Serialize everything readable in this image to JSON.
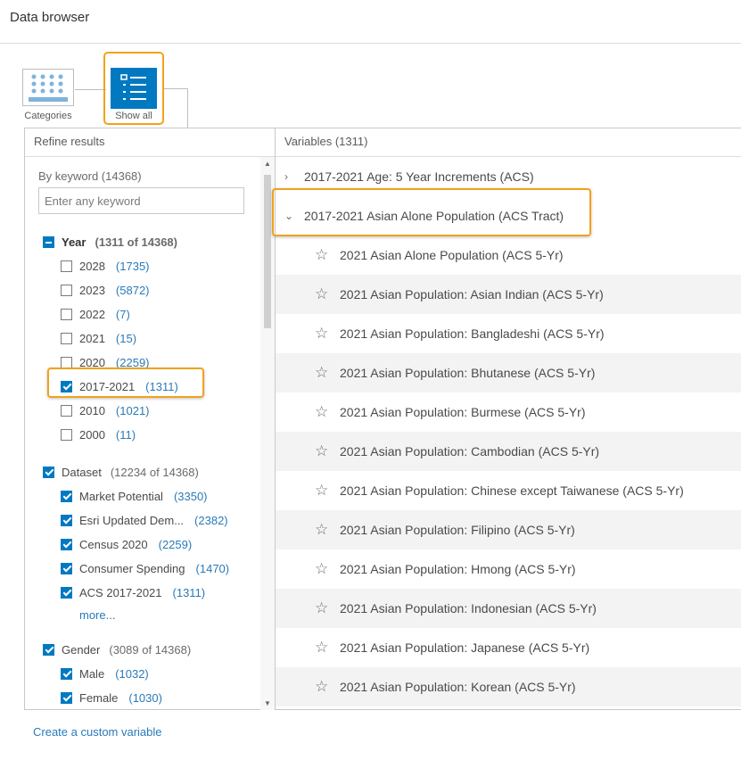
{
  "header": {
    "title": "Data browser"
  },
  "modes": {
    "categories_label": "Categories",
    "show_all_label": "Show all"
  },
  "refine": {
    "title": "Refine results",
    "keyword_label": "By keyword (14368)",
    "keyword_placeholder": "Enter any keyword",
    "year": {
      "label": "Year",
      "count": "(1311 of 14368)",
      "items": [
        {
          "label": "2028",
          "count": "(1735)",
          "checked": false
        },
        {
          "label": "2023",
          "count": "(5872)",
          "checked": false
        },
        {
          "label": "2022",
          "count": "(7)",
          "checked": false
        },
        {
          "label": "2021",
          "count": "(15)",
          "checked": false
        },
        {
          "label": "2020",
          "count": "(2259)",
          "checked": false
        },
        {
          "label": "2017-2021",
          "count": "(1311)",
          "checked": true
        },
        {
          "label": "2010",
          "count": "(1021)",
          "checked": false
        },
        {
          "label": "2000",
          "count": "(11)",
          "checked": false
        }
      ]
    },
    "dataset": {
      "label": "Dataset",
      "count": "(12234 of 14368)",
      "items": [
        {
          "label": "Market Potential",
          "count": "(3350)",
          "checked": true
        },
        {
          "label": "Esri Updated Dem...",
          "count": "(2382)",
          "checked": true
        },
        {
          "label": "Census 2020",
          "count": "(2259)",
          "checked": true
        },
        {
          "label": "Consumer Spending",
          "count": "(1470)",
          "checked": true
        },
        {
          "label": "ACS 2017-2021",
          "count": "(1311)",
          "checked": true
        }
      ],
      "more": "more..."
    },
    "gender": {
      "label": "Gender",
      "count": "(3089 of 14368)",
      "items": [
        {
          "label": "Male",
          "count": "(1032)",
          "checked": true
        },
        {
          "label": "Female",
          "count": "(1030)",
          "checked": true
        }
      ]
    }
  },
  "variables": {
    "title": "Variables (1311)",
    "groups": [
      {
        "label": "2017-2021 Age: 5 Year Increments (ACS)",
        "expanded": false
      },
      {
        "label": "2017-2021 Asian Alone Population (ACS Tract)",
        "expanded": true
      }
    ],
    "items": [
      "2021 Asian Alone Population (ACS 5-Yr)",
      "2021 Asian Population: Asian Indian (ACS 5-Yr)",
      "2021 Asian Population: Bangladeshi (ACS 5-Yr)",
      "2021 Asian Population: Bhutanese (ACS 5-Yr)",
      "2021 Asian Population: Burmese (ACS 5-Yr)",
      "2021 Asian Population: Cambodian (ACS 5-Yr)",
      "2021 Asian Population: Chinese except Taiwanese (ACS 5-Yr)",
      "2021 Asian Population: Filipino (ACS 5-Yr)",
      "2021 Asian Population: Hmong (ACS 5-Yr)",
      "2021 Asian Population: Indonesian (ACS 5-Yr)",
      "2021 Asian Population: Japanese (ACS 5-Yr)",
      "2021 Asian Population: Korean (ACS 5-Yr)"
    ]
  },
  "footer": {
    "custom_variable_link": "Create a custom variable"
  },
  "colors": {
    "accent": "#0079c1",
    "highlight": "#f0a21c",
    "link": "#2a7ab8"
  }
}
